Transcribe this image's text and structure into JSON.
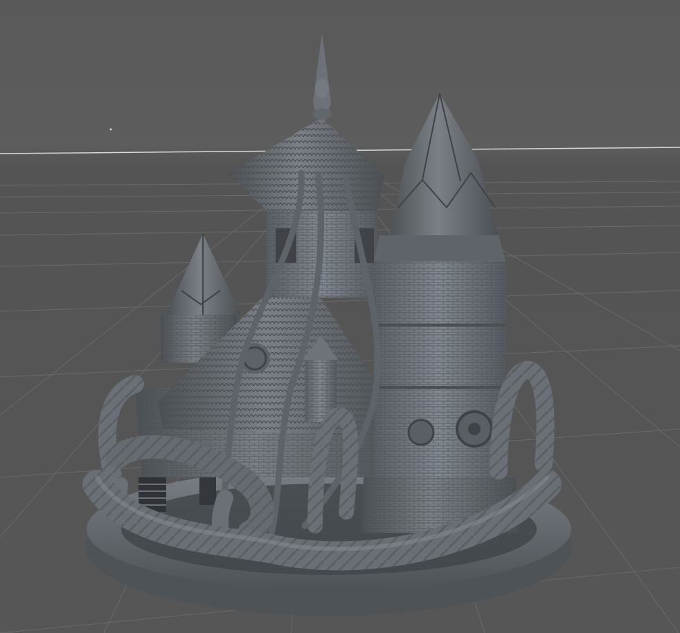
{
  "viewport": {
    "background_color": "#5b5b5b",
    "grid_color": "#6a6a6a",
    "horizon_color": "#d8d8d8",
    "model_color": "#6e7379",
    "model_shadow_color": "#3f4347"
  },
  "scene": {
    "object": "castle-miniature-with-tentacles-on-round-base",
    "render_mode": "solid-gray-preview",
    "grid": true
  }
}
